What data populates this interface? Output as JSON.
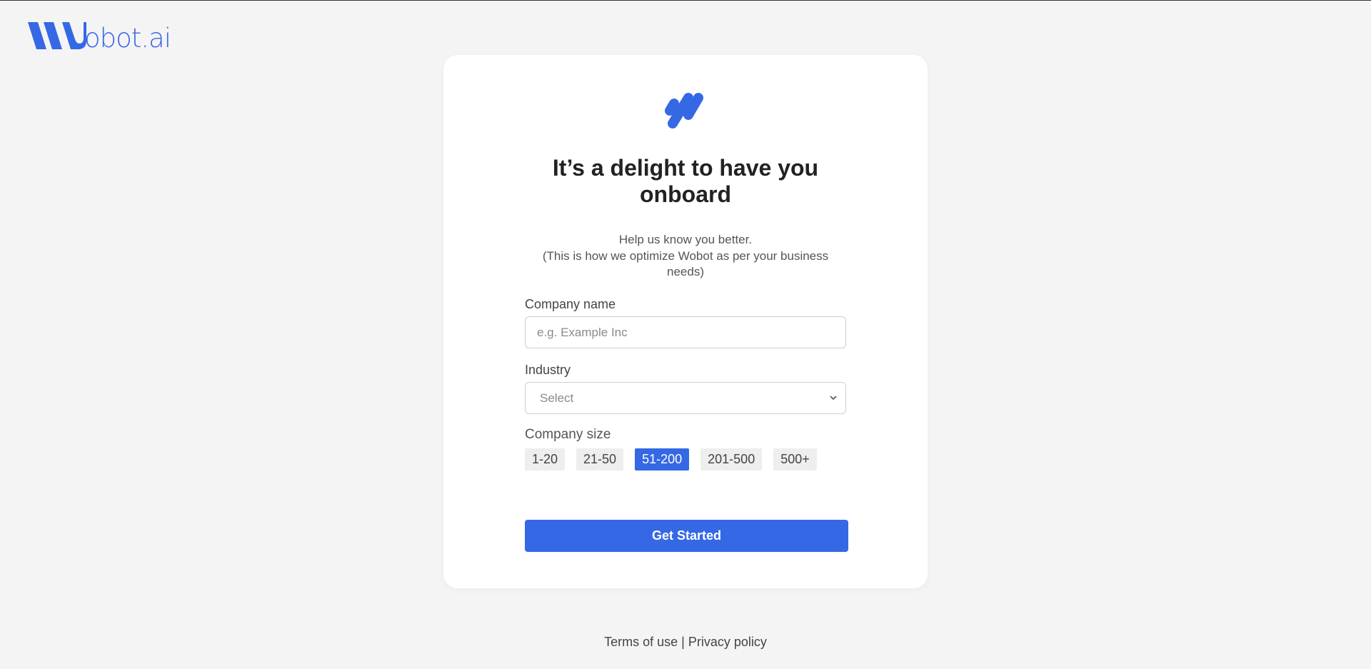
{
  "brand": {
    "logo_text": "obot.ai",
    "accent_color": "#3568e5"
  },
  "card": {
    "logo_icon": "wobot-mark-icon",
    "title": "It’s a delight to have you onboard",
    "subtitle_line1": "Help us know you better.",
    "subtitle_line2": "(This is how we optimize Wobot as per your business needs)"
  },
  "form": {
    "company_name": {
      "label": "Company name",
      "placeholder": "e.g. Example Inc",
      "value": ""
    },
    "industry": {
      "label": "Industry",
      "selected": "Select"
    },
    "company_size": {
      "label": "Company size",
      "options": [
        "1-20",
        "21-50",
        "51-200",
        "201-500",
        "500+"
      ],
      "selected": "51-200"
    },
    "submit_label": "Get Started"
  },
  "footer": {
    "terms": "Terms of use",
    "separator": "|",
    "privacy": "Privacy policy"
  }
}
